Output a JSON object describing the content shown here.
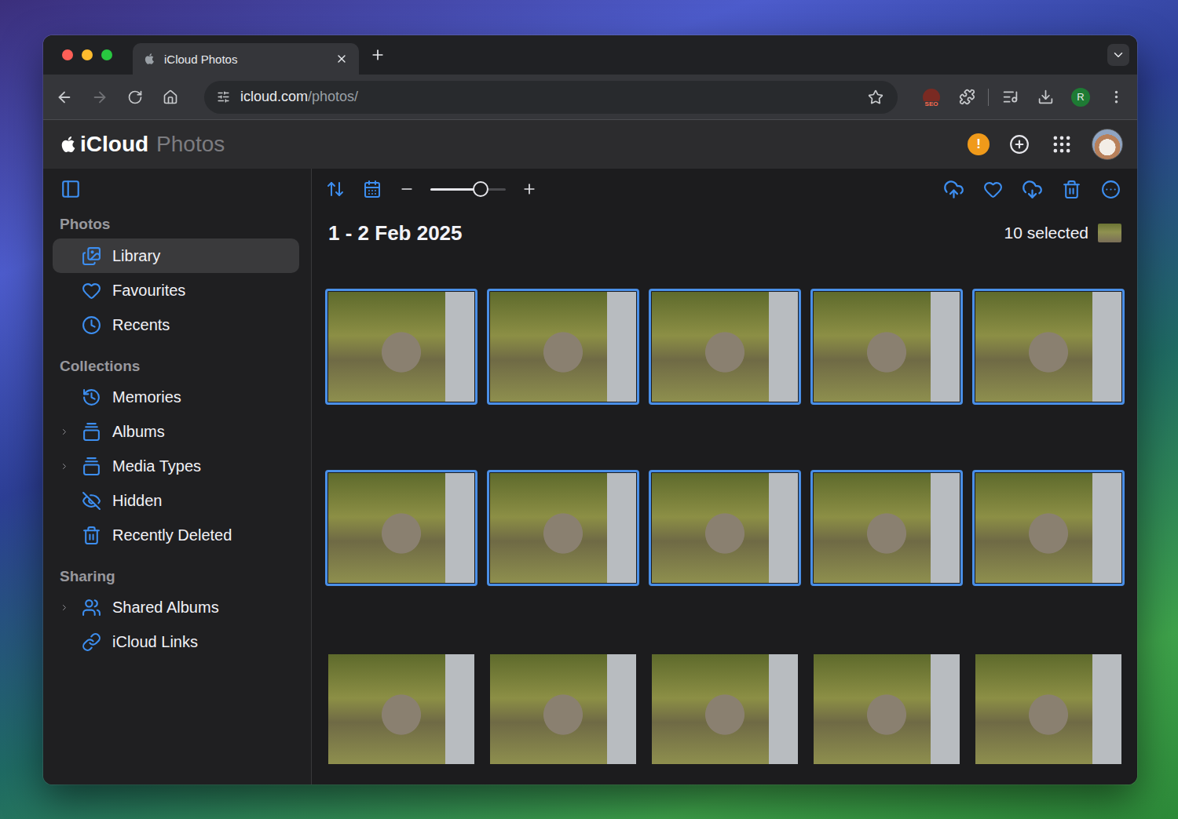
{
  "window": {
    "tab_title": "iCloud Photos"
  },
  "browser": {
    "url_host": "icloud.com",
    "url_path": "/photos/",
    "back_enabled": true,
    "forward_enabled": false,
    "bookmarked": false,
    "extension_badge": "SEO",
    "profile_initial": "R"
  },
  "app": {
    "brand": "iCloud",
    "section": "Photos",
    "alert_badge": "!"
  },
  "sidebar": {
    "sections": [
      {
        "title": "Photos",
        "items": [
          {
            "label": "Library",
            "selected": true,
            "expandable": false,
            "expanded": false
          },
          {
            "label": "Favourites",
            "selected": false,
            "expandable": false,
            "expanded": false
          },
          {
            "label": "Recents",
            "selected": false,
            "expandable": false,
            "expanded": false
          }
        ]
      },
      {
        "title": "Collections",
        "items": [
          {
            "label": "Memories",
            "selected": false,
            "expandable": false,
            "expanded": false
          },
          {
            "label": "Albums",
            "selected": false,
            "expandable": true,
            "expanded": false
          },
          {
            "label": "Media Types",
            "selected": false,
            "expandable": true,
            "expanded": false
          },
          {
            "label": "Hidden",
            "selected": false,
            "expandable": false,
            "expanded": false
          },
          {
            "label": "Recently Deleted",
            "selected": false,
            "expandable": false,
            "expanded": false
          }
        ]
      },
      {
        "title": "Sharing",
        "items": [
          {
            "label": "Shared Albums",
            "selected": false,
            "expandable": true,
            "expanded": false
          },
          {
            "label": "iCloud Links",
            "selected": false,
            "expandable": false,
            "expanded": false
          }
        ]
      }
    ]
  },
  "toolbar": {
    "zoom_level": 0.67
  },
  "content": {
    "date_range": "1 - 2 Feb 2025",
    "selection_count": "10 selected",
    "photos": [
      {
        "selected": true
      },
      {
        "selected": true
      },
      {
        "selected": true
      },
      {
        "selected": true
      },
      {
        "selected": true
      },
      {
        "selected": true
      },
      {
        "selected": true
      },
      {
        "selected": true
      },
      {
        "selected": true
      },
      {
        "selected": true
      },
      {
        "selected": false
      },
      {
        "selected": false
      },
      {
        "selected": false
      },
      {
        "selected": false
      },
      {
        "selected": false
      }
    ]
  }
}
